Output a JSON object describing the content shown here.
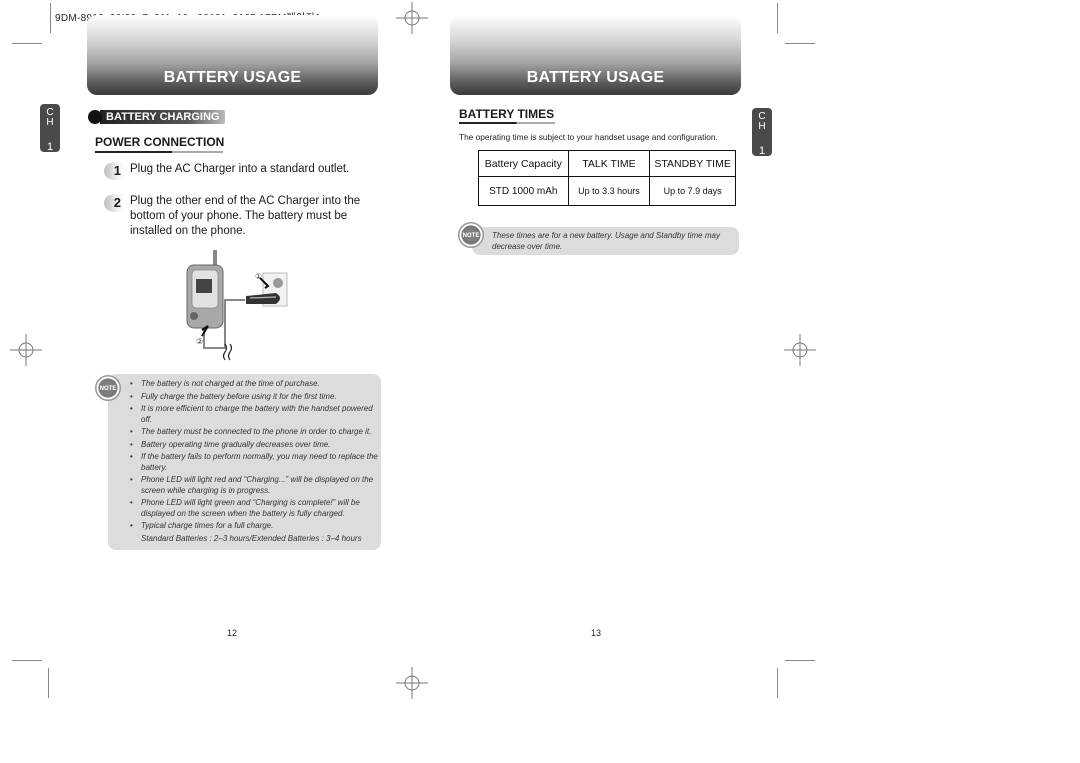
{
  "slug": "9DM-8910_90I99_7_011_10 _00101_0105:17PM페이지1_",
  "left_page": {
    "banner_title": "BATTERY USAGE",
    "chapter_tab": {
      "letters": [
        "C",
        "H"
      ],
      "number": "1"
    },
    "section_label": "BATTERY CHARGING",
    "subheading": "POWER CONNECTION",
    "steps": [
      {
        "num": "1",
        "text": "Plug the AC Charger into a standard outlet."
      },
      {
        "num": "2",
        "text": "Plug the other end of the AC Charger into the bottom of your phone. The battery must be installed on the phone."
      }
    ],
    "illustration": {
      "callout_1": "①",
      "callout_2": "②"
    },
    "note_icon": "NOTE",
    "notes": [
      "The battery is not charged at the time of purchase.",
      "Fully charge the battery before using it for the first time.",
      "It is more efficient to charge the battery with the handset powered off.",
      "The battery must be connected to the phone in order to charge it.",
      "Battery operating time gradually decreases over time.",
      "If the battery fails to perform normally, you may need to replace the battery.",
      "Phone LED will light red and “Charging...” will be displayed  on the screen while charging is in progress.",
      "Phone LED will light green and “Charging is complete!” will be displayed on the screen when the battery is fully charged.",
      "Typical charge times for a full charge."
    ],
    "notes_extra": "Standard Batteries : 2–3 hours/Extended Batteries : 3–4 hours",
    "page_number": "12"
  },
  "right_page": {
    "banner_title": "BATTERY USAGE",
    "chapter_tab": {
      "letters": [
        "C",
        "H"
      ],
      "number": "1"
    },
    "subheading": "BATTERY TIMES",
    "intro": "The operating time is subject to your handset usage and configuration.",
    "table": {
      "headers": [
        "Battery Capacity",
        "TALK TIME",
        "STANDBY TIME"
      ],
      "rows": [
        [
          "STD 1000 mAh",
          "Up to 3.3 hours",
          "Up to 7.9 days"
        ]
      ]
    },
    "note_icon": "NOTE",
    "note": "These times are for a new battery. Usage and Standby time may decrease over time.",
    "page_number": "13"
  }
}
